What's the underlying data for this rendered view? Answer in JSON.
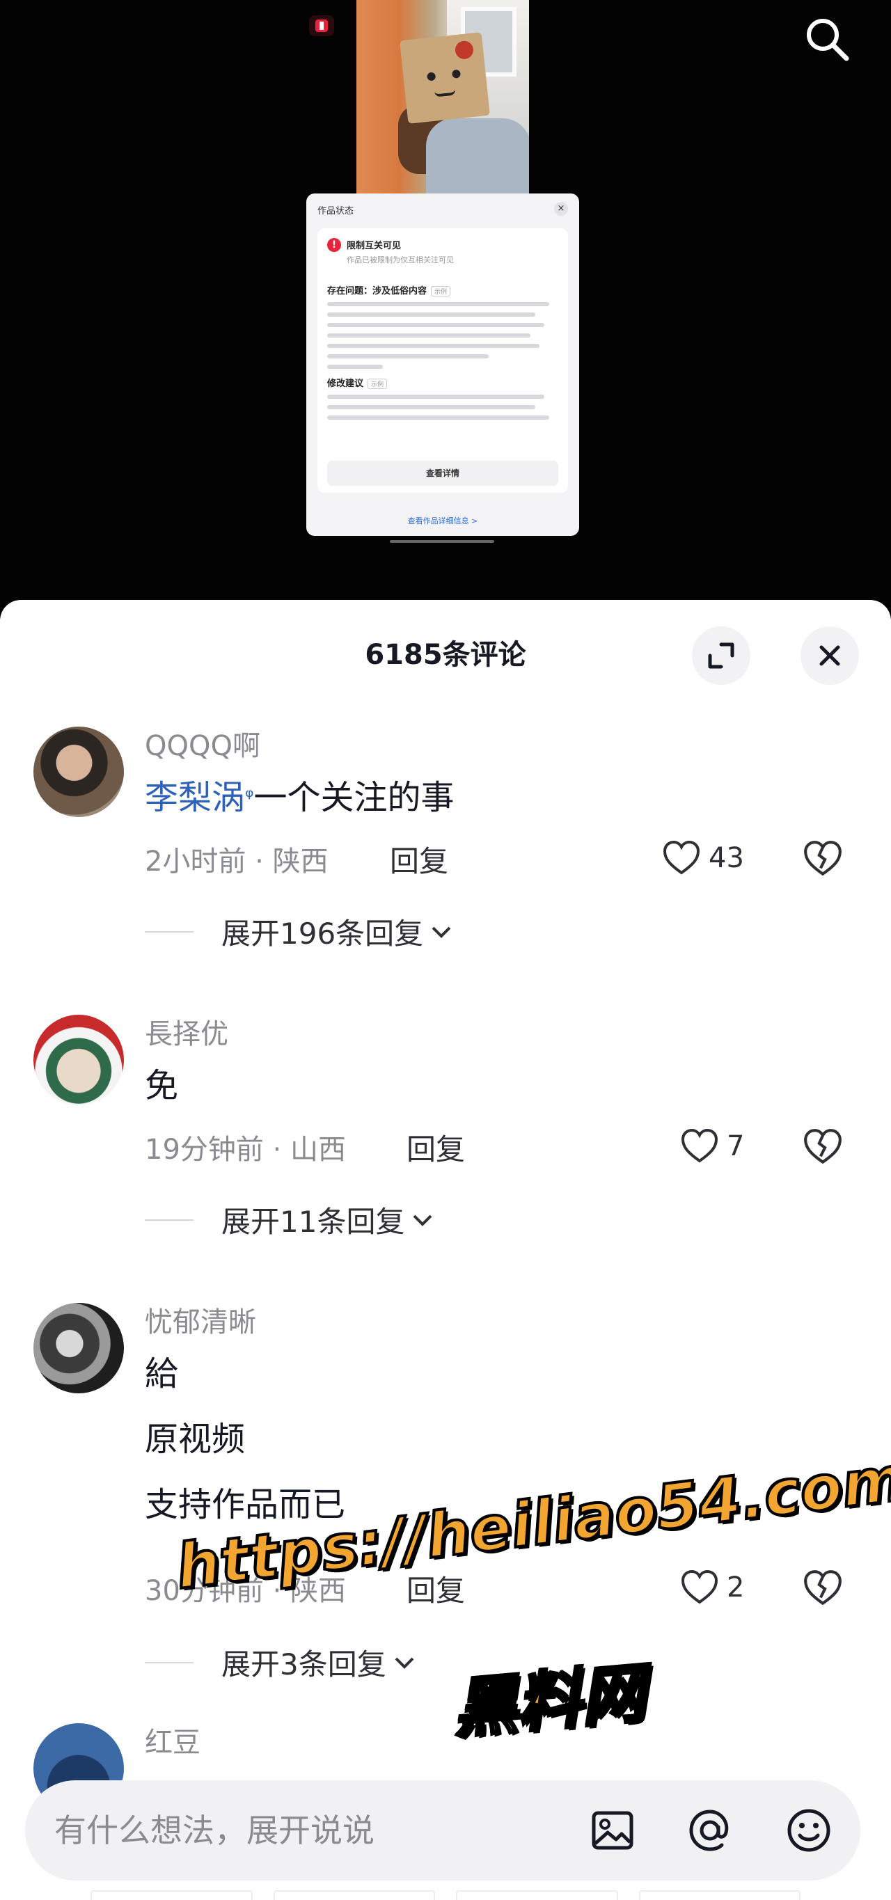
{
  "video": {
    "notice": {
      "title": "作品状态",
      "close": "×",
      "alert_title": "限制互关可见",
      "alert_sub": "作品已被限制为仅互相关注可见",
      "issue_title": "存在问题：涉及低俗内容",
      "issue_tag": "示例",
      "suggest_title": "修改建议",
      "suggest_tag": "示例",
      "detail_button": "查看详情",
      "footer_link": "查看作品详细信息 >"
    }
  },
  "comments_sheet": {
    "title": "6185条评论",
    "comments": [
      {
        "user": "QQQQ啊",
        "mention": "李梨涡",
        "search_mark": "ᵠ",
        "text": "一个关注的事",
        "meta": "2小时前 · 陕西",
        "reply_label": "回复",
        "likes": "43",
        "expand": "展开196条回复"
      },
      {
        "user": "長择优",
        "text": "免",
        "meta": "19分钟前 · 山西",
        "reply_label": "回复",
        "likes": "7",
        "expand": "展开11条回复"
      },
      {
        "user": "忧郁清晰",
        "lines": [
          "給",
          "原视频",
          "支持作品而已"
        ],
        "meta": "30分钟前 · 陕西",
        "reply_label": "回复",
        "likes": "2",
        "expand": "展开3条回复"
      },
      {
        "user": "红豆"
      }
    ],
    "input": {
      "placeholder": "有什么想法，展开说说"
    }
  },
  "watermark": {
    "url": "https://heiliao54.com",
    "name": "黑料网"
  },
  "colors": {
    "mention": "#2d62b8",
    "watermark": "#f2a531",
    "alert": "#e8233a"
  },
  "icons": [
    "search-icon",
    "expand-icon",
    "close-icon",
    "heart-icon",
    "broken-heart-icon",
    "chevron-down-icon",
    "image-icon",
    "at-icon",
    "emoji-icon"
  ]
}
